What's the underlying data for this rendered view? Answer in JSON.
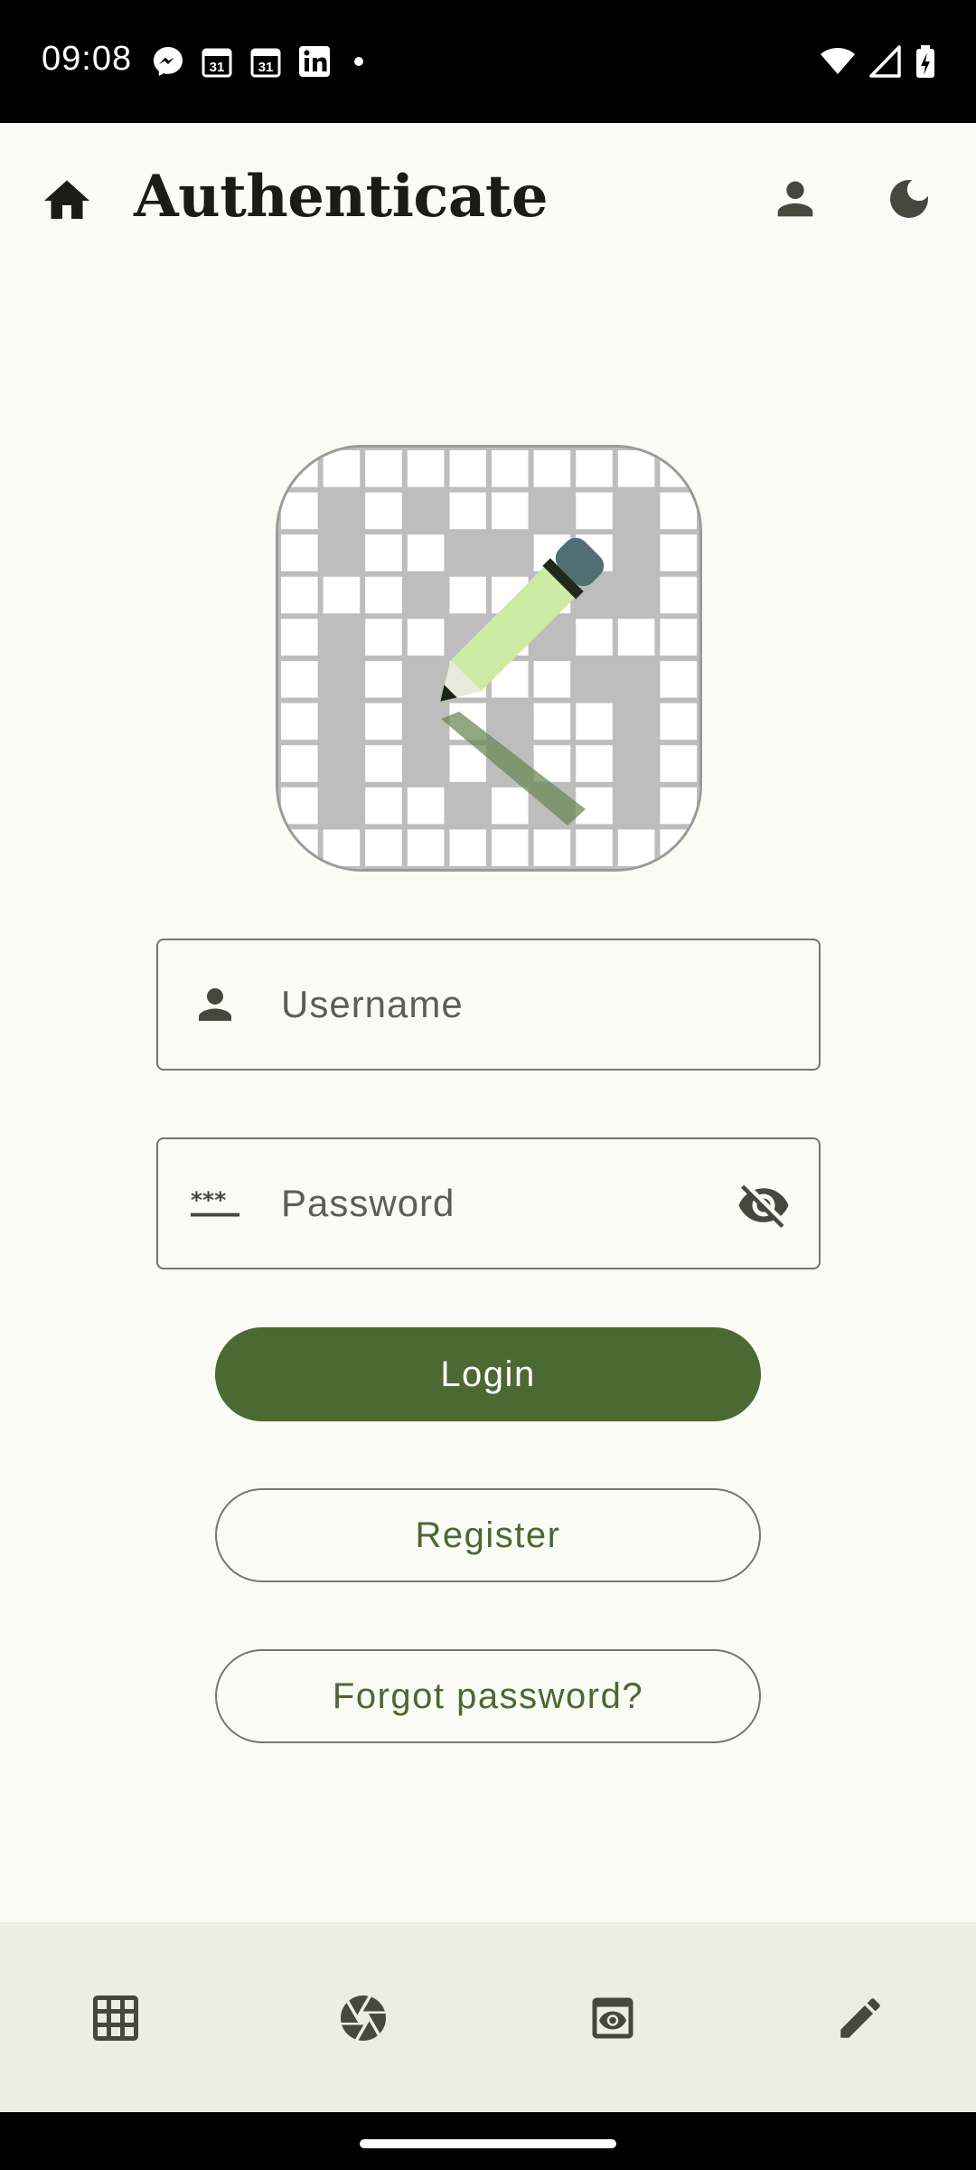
{
  "status_bar": {
    "time": "09:08",
    "notification_icons": [
      "messenger-icon",
      "calendar-icon",
      "calendar-icon",
      "linkedin-icon",
      "dot-icon"
    ],
    "calendar_day": "31",
    "system_icons": [
      "wifi-icon",
      "signal-icon",
      "battery-charging-icon"
    ]
  },
  "top_bar": {
    "title": "Authenticate",
    "home_icon": "home-icon",
    "profile_icon": "person-icon",
    "theme_icon": "dark-mode-icon"
  },
  "logo": {
    "name": "crossword-pencil-logo"
  },
  "form": {
    "username": {
      "placeholder": "Username",
      "value": "",
      "icon": "person-icon"
    },
    "password": {
      "placeholder": "Password",
      "value": "",
      "icon": "password-icon",
      "toggle_icon": "visibility-off-icon"
    }
  },
  "buttons": {
    "login": "Login",
    "register": "Register",
    "forgot": "Forgot password?"
  },
  "bottom_nav": {
    "items": [
      "grid-icon",
      "camera-shutter-icon",
      "preview-icon",
      "edit-icon"
    ]
  },
  "colors": {
    "primary": "#4c6833",
    "background": "#fafbf4",
    "nav_background": "#eceee4",
    "outline": "#76786b"
  }
}
